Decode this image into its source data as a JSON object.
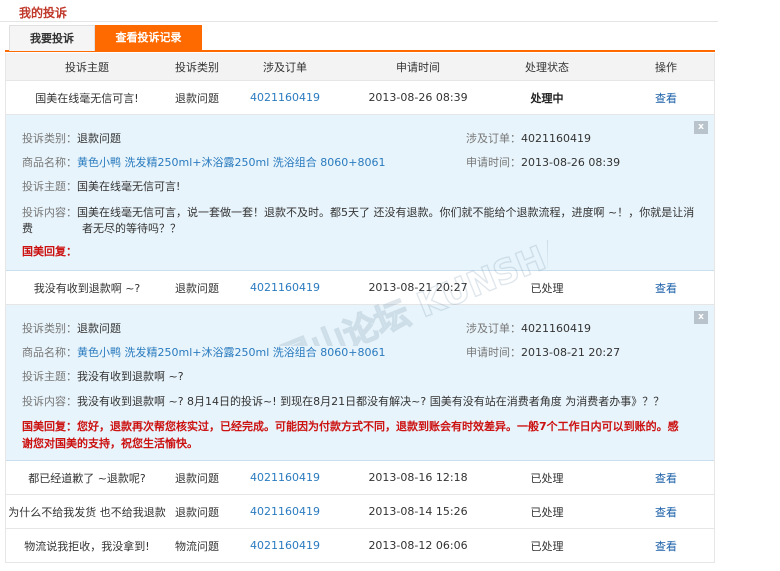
{
  "page_title": "我的投诉",
  "tabs": [
    {
      "label": "我要投诉",
      "active": false
    },
    {
      "label": "查看投诉记录",
      "active": true
    }
  ],
  "headers": [
    "投诉主题",
    "投诉类别",
    "涉及订单",
    "申请时间",
    "处理状态",
    "操作"
  ],
  "complaints": [
    {
      "subject": "国美在线毫无信可言!",
      "type": "退款问题",
      "order": "4021160419",
      "time": "2013-08-26 08:39",
      "status": "处理中",
      "op": "查看",
      "detail": {
        "type_label": "投诉类别：",
        "type_value": "退款问题",
        "order_label": "涉及订单：",
        "order_value": "4021160419",
        "product_label": "商品名称：",
        "product_value": "黄色小鸭 洗发精250ml+沐浴露250ml 洗浴组合 8060+8061",
        "time_label": "申请时间：",
        "time_value": "2013-08-26 08:39",
        "subject_label": "投诉主题：",
        "subject_value": "国美在线毫无信可言!",
        "content_label": "投诉内容：",
        "content_line1": "国美在线毫无信可言，说一套做一套！退款不及时。都5天了 还没有退款。你们就不能给个退款流程，进度啊 ~！，你就是让消费",
        "content_line2": "者无尽的等待吗？？",
        "reply_label": "国美回复：",
        "reply_text": ""
      }
    },
    {
      "subject": "我没有收到退款啊 ~?",
      "type": "退款问题",
      "order": "4021160419",
      "time": "2013-08-21 20:27",
      "status": "已处理",
      "op": "查看",
      "detail": {
        "type_label": "投诉类别：",
        "type_value": "退款问题",
        "order_label": "涉及订单：",
        "order_value": "4021160419",
        "product_label": "商品名称：",
        "product_value": "黄色小鸭 洗发精250ml+沐浴露250ml 洗浴组合 8060+8061",
        "time_label": "申请时间：",
        "time_value": "2013-08-21 20:27",
        "subject_label": "投诉主题：",
        "subject_value": "我没有收到退款啊 ~?",
        "content_label": "投诉内容：",
        "content_line1": "我没有收到退款啊 ~? 8月14日的投诉~! 到现在8月21日都没有解决~? 国美有没有站在消费者角度 为消费者办事》？？",
        "content_line2": "",
        "reply_label": "国美回复：",
        "reply_text": "您好，退款再次帮您核实过，已经完成。可能因为付款方式不同，退款到账会有时效差异。一般7个工作日内可以到账的。感",
        "reply_text2": "谢您对国美的支持，祝您生活愉快。"
      }
    },
    {
      "subject": "都已经道歉了 ~退款呢?",
      "type": "退款问题",
      "order": "4021160419",
      "time": "2013-08-16 12:18",
      "status": "已处理",
      "op": "查看"
    },
    {
      "subject": "为什么不给我发货 也不给我退款",
      "type": "退款问题",
      "order": "4021160419",
      "time": "2013-08-14 15:26",
      "status": "已处理",
      "op": "查看"
    },
    {
      "subject": "物流说我拒收，我没拿到!",
      "type": "物流问题",
      "order": "4021160419",
      "time": "2013-08-12 06:06",
      "status": "已处理",
      "op": "查看"
    }
  ],
  "close_glyph": "x",
  "watermark": "昆山论坛 KUNSHANBBS",
  "colors": {
    "accent": "#ff6a00",
    "link": "#1a5fa8",
    "reply": "#cc1111",
    "detail_bg": "#e8f4fb"
  }
}
